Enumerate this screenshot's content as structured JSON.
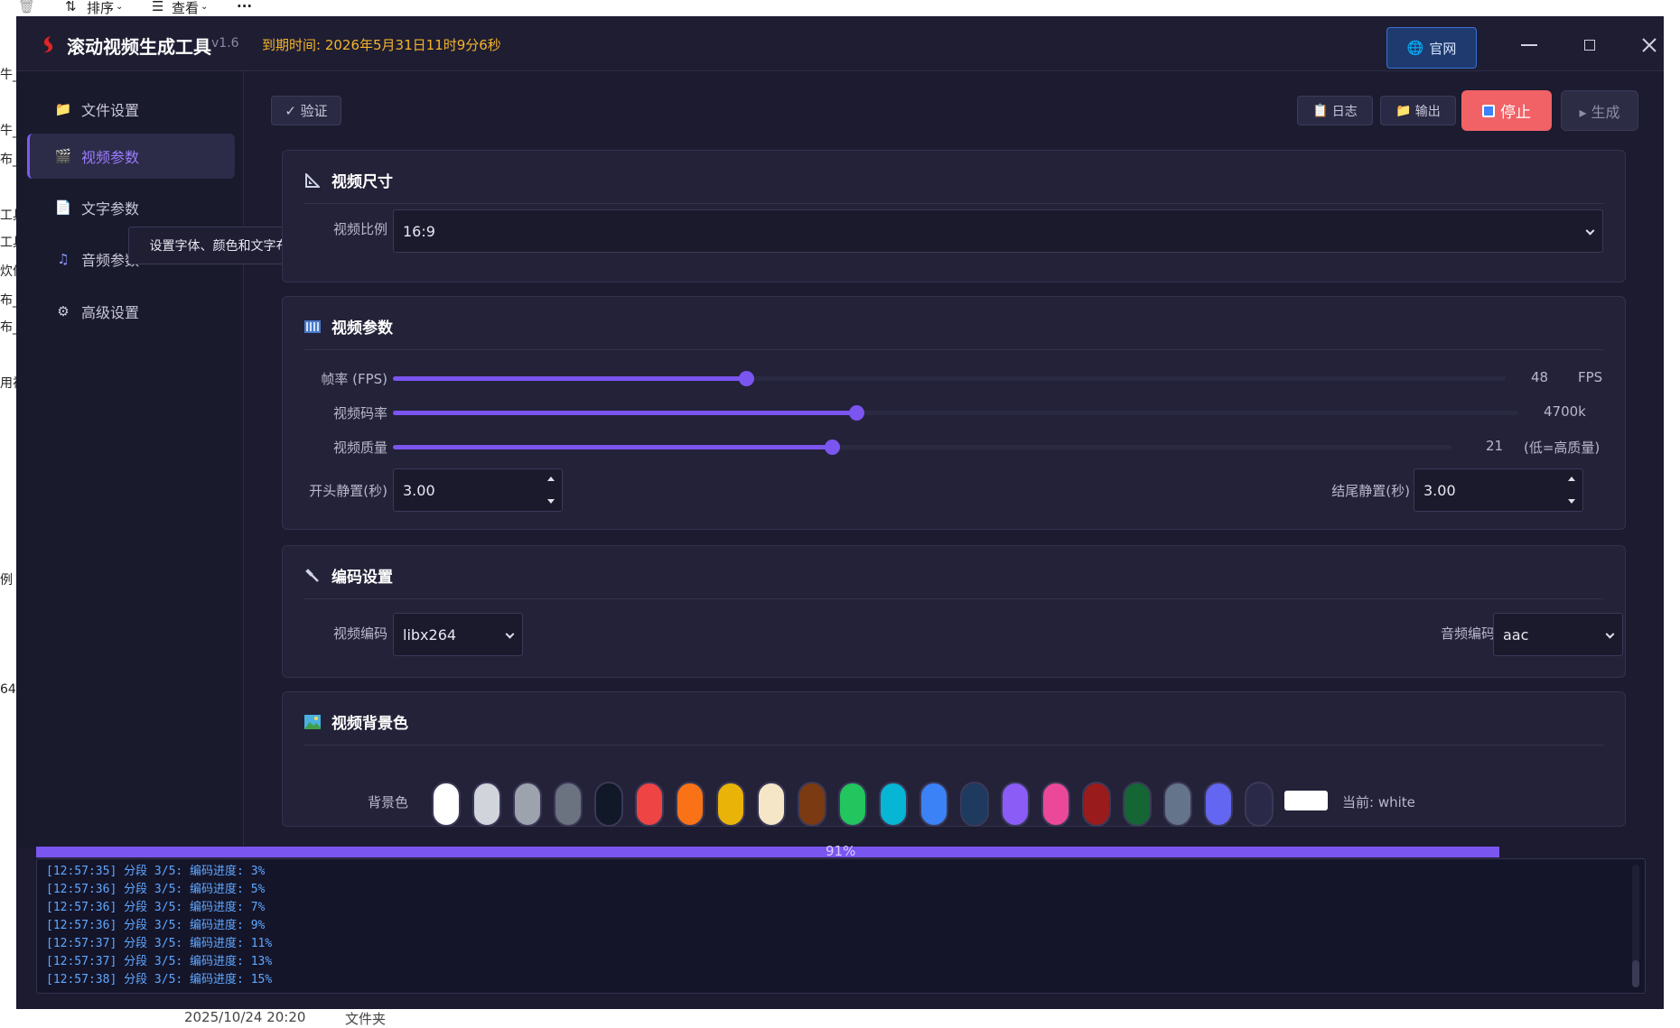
{
  "background": {
    "toolbar": {
      "sort_label": "排序",
      "view_label": "查看",
      "more": "···"
    },
    "left_fragments": [
      "牛_",
      "牛_",
      "布_",
      "工具",
      "工具",
      "炊件",
      "布_",
      "布_",
      "用视",
      "例",
      "64"
    ],
    "bottom_date": "2025/10/24 20:20",
    "bottom_type": "文件夹"
  },
  "app": {
    "title": "滚动视频生成工具",
    "version": "v1.6",
    "expiry": "到期时间: 2026年5月31日11时9分6秒",
    "website_label": "官网"
  },
  "sidebar": {
    "items": [
      {
        "label": "文件设置",
        "icon": "folder-icon"
      },
      {
        "label": "视频参数",
        "icon": "clapper-icon"
      },
      {
        "label": "文字参数",
        "icon": "document-icon"
      },
      {
        "label": "音频参数",
        "icon": "music-icon"
      },
      {
        "label": "高级设置",
        "icon": "gear-icon"
      }
    ],
    "active_index": 1
  },
  "tooltip": "设置字体、颜色和文字布局",
  "toolbar": {
    "verify_label": "✓ 验证",
    "log_label": "日志",
    "output_label": "输出",
    "stop_label": "停止",
    "generate_label": "▸ 生成"
  },
  "size_card": {
    "title": "视频尺寸",
    "ratio_label": "视频比例",
    "ratio_value": "16:9"
  },
  "params_card": {
    "title": "视频参数",
    "fps": {
      "label": "帧率 (FPS)",
      "value": "48",
      "unit": "FPS",
      "fraction": 0.317
    },
    "bitrate": {
      "label": "视频码率",
      "value": "4700k",
      "unit": "",
      "fraction": 0.412
    },
    "quality": {
      "label": "视频质量",
      "value": "21",
      "unit": "(低=高质量)",
      "fraction": 0.415
    },
    "start_pause_label": "开头静置(秒)",
    "start_pause_value": "3.00",
    "end_pause_label": "结尾静置(秒)",
    "end_pause_value": "3.00"
  },
  "codec_card": {
    "title": "编码设置",
    "video_codec_label": "视频编码",
    "video_codec_value": "libx264",
    "audio_codec_label": "音频编码",
    "audio_codec_value": "aac"
  },
  "bg_card": {
    "title": "视频背景色",
    "label": "背景色",
    "swatches": [
      "#ffffff",
      "#d1d5db",
      "#9ca3af",
      "#6b7280",
      "#111827",
      "#ef4444",
      "#f97316",
      "#eab308",
      "#f5e6c8",
      "#7c3a12",
      "#22c55e",
      "#06b6d4",
      "#3b82f6",
      "#1e3a5f",
      "#8b5cf6",
      "#ec4899",
      "#991b1b",
      "#166534",
      "#64748b",
      "#6366f1",
      "#2a2a48"
    ],
    "current_label": "当前: white",
    "current_color": "#ffffff"
  },
  "progress": {
    "percent": 91,
    "label": "91%"
  },
  "log": [
    "[12:57:35] 分段 3/5: 编码进度: 3%",
    "[12:57:36] 分段 3/5: 编码进度: 5%",
    "[12:57:36] 分段 3/5: 编码进度: 7%",
    "[12:57:36] 分段 3/5: 编码进度: 9%",
    "[12:57:37] 分段 3/5: 编码进度: 11%",
    "[12:57:37] 分段 3/5: 编码进度: 13%",
    "[12:57:38] 分段 3/5: 编码进度: 15%"
  ]
}
